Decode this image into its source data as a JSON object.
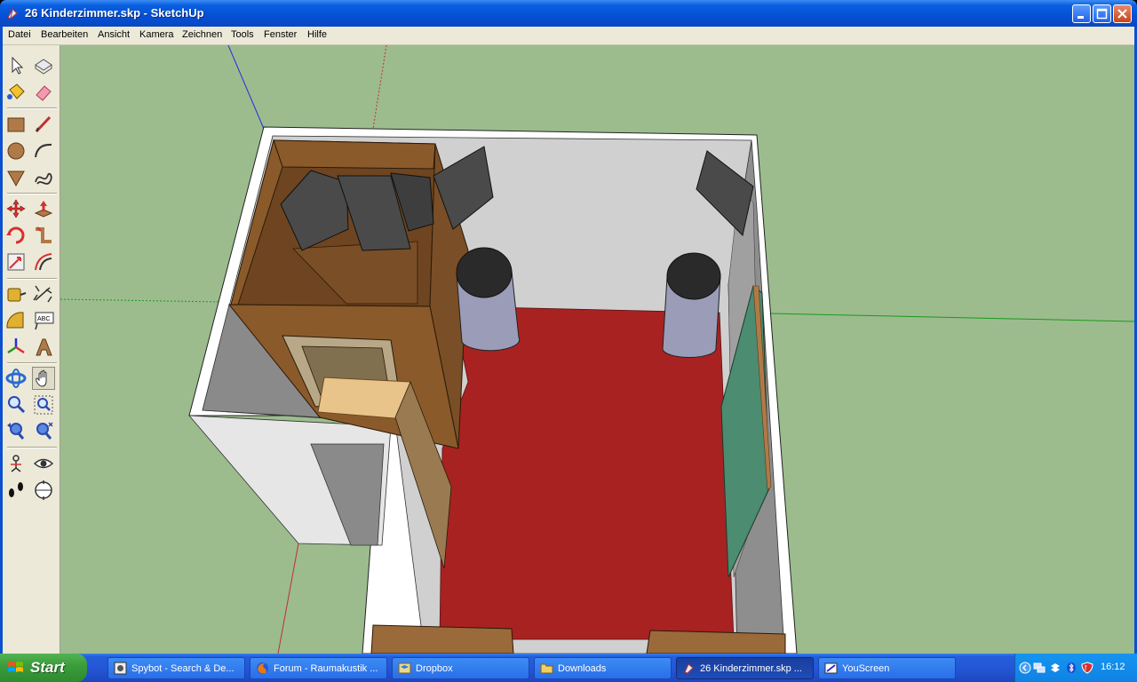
{
  "window": {
    "title": "26 Kinderzimmer.skp - SketchUp"
  },
  "menu": {
    "items": [
      "Datei",
      "Bearbeiten",
      "Ansicht",
      "Kamera",
      "Zeichnen",
      "Tools",
      "Fenster",
      "Hilfe"
    ]
  },
  "toolbar": {
    "tools": [
      "select-tool",
      "make-component-tool",
      "paint-bucket-tool",
      "eraser-tool",
      "rectangle-tool",
      "line-tool",
      "circle-tool",
      "arc-tool",
      "polygon-tool",
      "freehand-tool",
      "move-tool",
      "push-pull-tool",
      "rotate-tool",
      "follow-me-tool",
      "scale-tool",
      "offset-tool",
      "tape-measure-tool",
      "dimension-tool",
      "protractor-tool",
      "text-tool",
      "axes-tool",
      "3d-text-tool",
      "orbit-tool",
      "pan-tool",
      "zoom-tool",
      "zoom-window-tool",
      "previous-view-tool",
      "zoom-extents-tool",
      "position-camera-tool",
      "look-around-tool",
      "walk-tool",
      "section-plane-tool"
    ],
    "active_tool": "pan-tool",
    "text_tool_label": "ABC"
  },
  "taskbar": {
    "start_label": "Start",
    "buttons": [
      {
        "label": "Spybot - Search & De...",
        "icon": "spybot-icon"
      },
      {
        "label": "Forum - Raumakustik ...",
        "icon": "firefox-icon"
      },
      {
        "label": "Dropbox",
        "icon": "dropbox-icon"
      },
      {
        "label": "Downloads",
        "icon": "folder-icon"
      },
      {
        "label": "26 Kinderzimmer.skp ...",
        "icon": "sketchup-icon",
        "active": true
      },
      {
        "label": "YouScreen",
        "icon": "youscreen-icon"
      }
    ],
    "clock": "16:12"
  },
  "colors": {
    "viewport_background": "#9cbc8e",
    "floor": "#a82222",
    "wood": "#8b5a2b",
    "wall": "#d2d2d2",
    "panel_dark": "#4a4a4a",
    "green_panel": "#4c8c70",
    "axis_blue": "#2a2ae0",
    "axis_green": "#1a9a1a",
    "axis_red": "#c03030"
  }
}
